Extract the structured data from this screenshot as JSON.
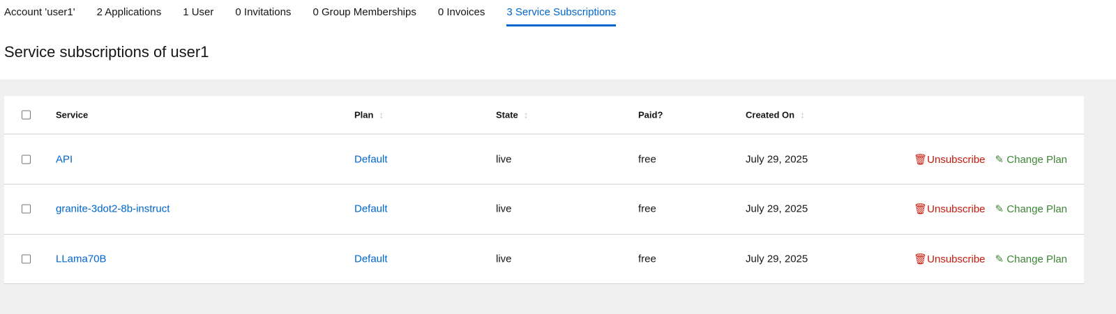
{
  "tabs": [
    {
      "label": "Account 'user1'"
    },
    {
      "label": "2 Applications"
    },
    {
      "label": "1 User"
    },
    {
      "label": "0 Invitations"
    },
    {
      "label": "0 Group Memberships"
    },
    {
      "label": "0 Invoices"
    },
    {
      "label": "3 Service Subscriptions",
      "active": true
    }
  ],
  "title": "Service subscriptions of user1",
  "table": {
    "headers": {
      "service": "Service",
      "plan": "Plan",
      "state": "State",
      "paid": "Paid?",
      "created": "Created On"
    },
    "rows": [
      {
        "service": "API",
        "plan": "Default",
        "state": "live",
        "paid": "free",
        "created": "July 29, 2025"
      },
      {
        "service": "granite-3dot2-8b-instruct",
        "plan": "Default",
        "state": "live",
        "paid": "free",
        "created": "July 29, 2025"
      },
      {
        "service": "LLama70B",
        "plan": "Default",
        "state": "live",
        "paid": "free",
        "created": "July 29, 2025"
      }
    ],
    "actions": {
      "unsubscribe": "Unsubscribe",
      "change_plan": "Change Plan"
    }
  },
  "icons": {
    "sort": "sort-icon",
    "unsubscribe": "trash-icon",
    "change_plan": "pencil-icon"
  },
  "colors": {
    "accent": "#0066cc",
    "danger": "#c9190b",
    "success": "#3e8635"
  }
}
